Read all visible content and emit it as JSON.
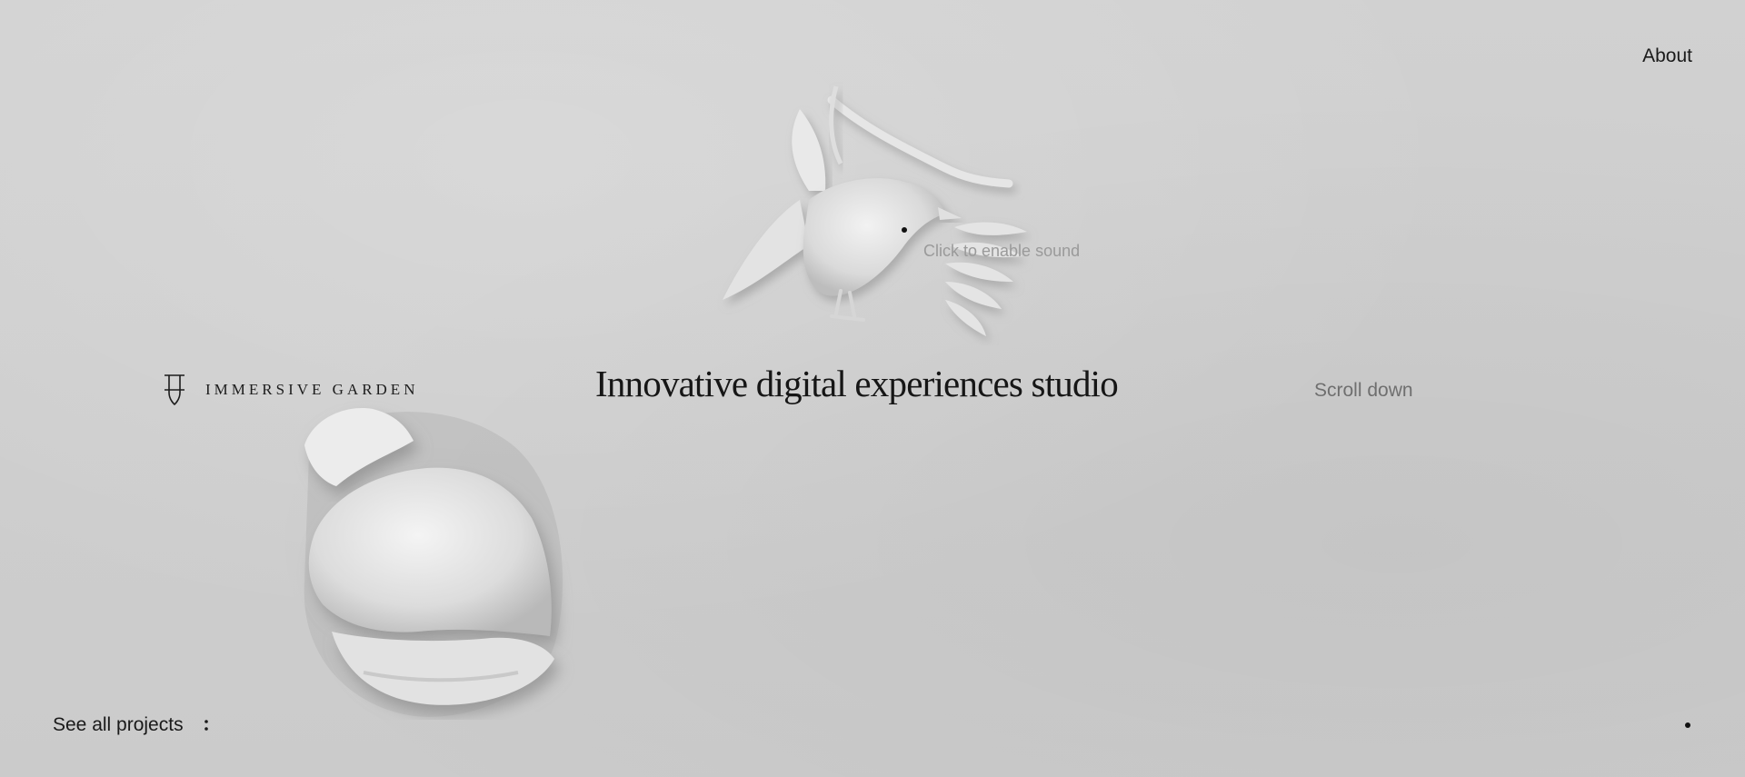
{
  "nav": {
    "about_label": "About"
  },
  "brand": {
    "name": "IMMERSIVE GARDEN",
    "logo_icon": "ig-monogram-icon"
  },
  "hero": {
    "headline": "Innovative digital experiences studio",
    "scroll_label": "Scroll down",
    "sound_label": "Click to enable sound"
  },
  "footer": {
    "projects_label": "See all projects",
    "projects_icon": "vertical-dots-icon",
    "indicator_icon": "dot-icon"
  },
  "colors": {
    "background": "#cfcfcf",
    "text": "#1c1c1c",
    "muted": "#6f6f6f",
    "hint": "#9a9a9a"
  }
}
